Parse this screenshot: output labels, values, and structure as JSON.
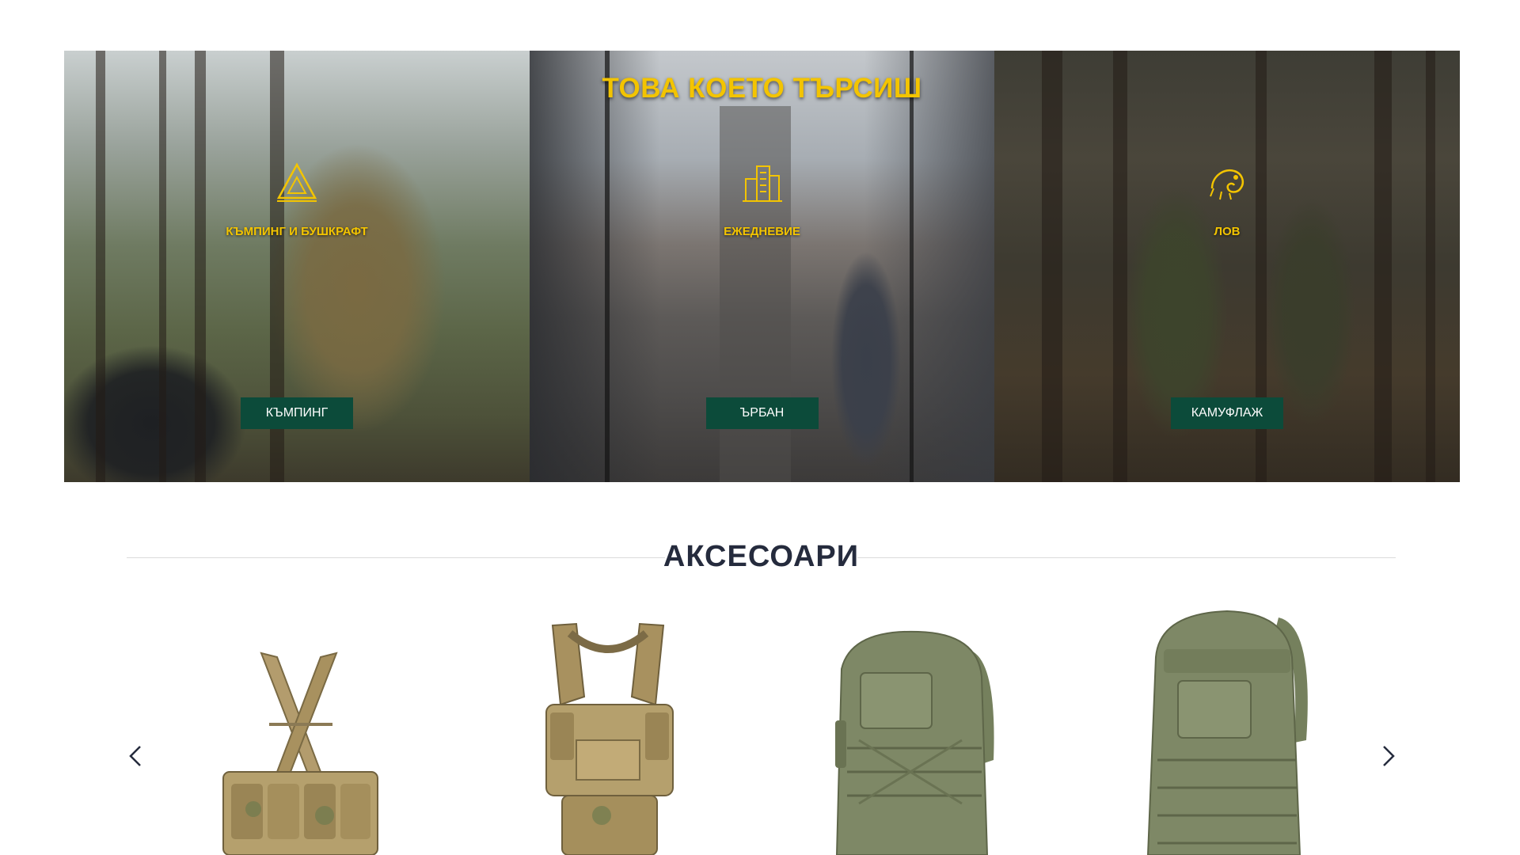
{
  "hero": {
    "title": "ТОВА КОЕТО ТЪРСИШ",
    "categories": [
      {
        "icon": "tent-icon",
        "label": "КЪМПИНГ И БУШКРАФТ",
        "button": "КЪМПИНГ"
      },
      {
        "icon": "city-buildings-icon",
        "label": "ЕЖЕДНЕВИЕ",
        "button": "ЪРБАН"
      },
      {
        "icon": "chameleon-icon",
        "label": "ЛОВ",
        "button": "КАМУФЛАЖ"
      }
    ]
  },
  "accessories": {
    "heading": "АКСЕСОАРИ",
    "prev_icon": "chevron-left-icon",
    "next_icon": "chevron-right-icon",
    "products": [
      {
        "type": "chest-rig-camo"
      },
      {
        "type": "plate-carrier-camo"
      },
      {
        "type": "backpack-olive"
      },
      {
        "type": "backpack-olive"
      }
    ]
  },
  "colors": {
    "accent_yellow": "#f3c400",
    "button_green": "#0c4b3a",
    "heading_dark": "#252b3d",
    "olive": "#7e8866"
  }
}
